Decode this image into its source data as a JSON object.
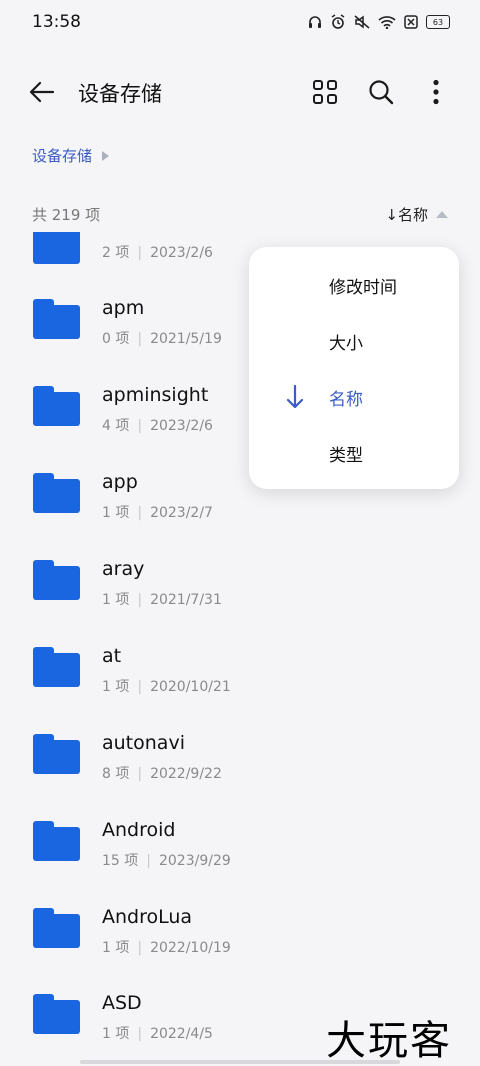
{
  "status": {
    "time": "13:58",
    "battery": "63"
  },
  "header": {
    "title": "设备存储"
  },
  "breadcrumb": {
    "items": [
      "设备存储"
    ]
  },
  "list_header": {
    "count": "共 219 项",
    "sort_label": "↓名称"
  },
  "files": [
    {
      "name": "",
      "count": "2 项",
      "date": "2023/2/6"
    },
    {
      "name": "apm",
      "count": "0 项",
      "date": "2021/5/19"
    },
    {
      "name": "apminsight",
      "count": "4 项",
      "date": "2023/2/6"
    },
    {
      "name": "app",
      "count": "1 项",
      "date": "2023/2/7"
    },
    {
      "name": "aray",
      "count": "1 项",
      "date": "2021/7/31"
    },
    {
      "name": "at",
      "count": "1 项",
      "date": "2020/10/21"
    },
    {
      "name": "autonavi",
      "count": "8 项",
      "date": "2022/9/22"
    },
    {
      "name": "Android",
      "count": "15 项",
      "date": "2023/9/29"
    },
    {
      "name": "AndroLua",
      "count": "1 项",
      "date": "2022/10/19"
    },
    {
      "name": "ASD",
      "count": "1 项",
      "date": "2022/4/5"
    }
  ],
  "sort_menu": {
    "options": [
      {
        "label": "修改时间",
        "selected": false
      },
      {
        "label": "大小",
        "selected": false
      },
      {
        "label": "名称",
        "selected": true
      },
      {
        "label": "类型",
        "selected": false
      }
    ]
  },
  "watermark": "大玩客",
  "colors": {
    "accent": "#3a5cc4",
    "folder": "#1a66e0",
    "background": "#f5f5f7"
  },
  "icons": {
    "back": "arrow-left-icon",
    "grid": "grid-view-icon",
    "search": "search-icon",
    "more": "more-vert-icon"
  }
}
